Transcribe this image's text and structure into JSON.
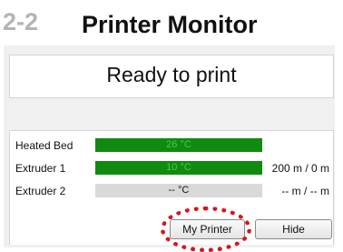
{
  "header": {
    "step_number": "2-2",
    "title": "Printer Monitor"
  },
  "status": {
    "text": "Ready to print"
  },
  "temperatures": [
    {
      "label": "Heated Bed",
      "value": "26 °C",
      "active": true,
      "extra": ""
    },
    {
      "label": "Extruder 1",
      "value": "10 °C",
      "active": true,
      "extra": "200 m / 0 m"
    },
    {
      "label": "Extruder 2",
      "value": "-- °C",
      "active": false,
      "extra": "-- m / -- m"
    }
  ],
  "buttons": {
    "my_printer": "My Printer",
    "hide": "Hide"
  },
  "colors": {
    "bar_fill": "#108a10",
    "bar_empty": "#d9d9d9",
    "highlight": "#d6151d",
    "step_number": "#b4b4b4"
  }
}
